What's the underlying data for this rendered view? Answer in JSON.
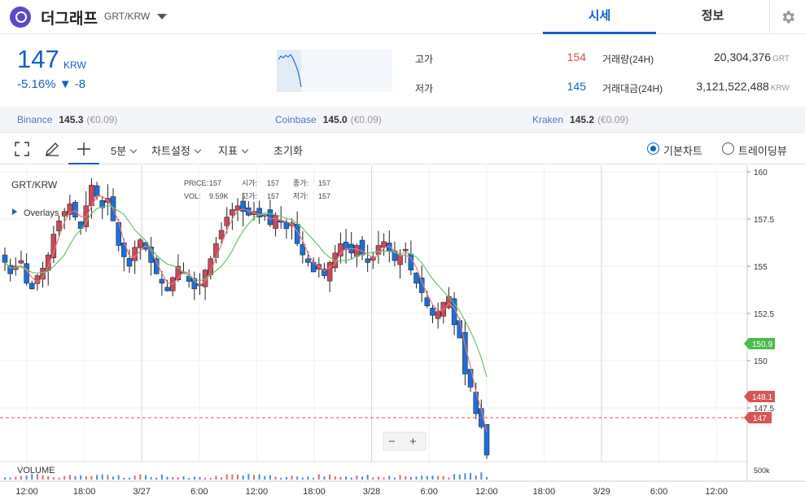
{
  "coin": {
    "name": "더그래프",
    "pair": "GRT/KRW"
  },
  "tabs": {
    "market": "시세",
    "info": "정보"
  },
  "summary": {
    "price": "147",
    "unit": "KRW",
    "change": "-5.16% ▼ -8",
    "high_label": "고가",
    "high": "154",
    "low_label": "저가",
    "low": "145",
    "volume_label": "거래량(24H)",
    "volume": "20,304,376",
    "volume_unit": "GRT",
    "amount_label": "거래대금(24H)",
    "amount": "3,121,522,488",
    "amount_unit": "KRW"
  },
  "exchanges": [
    {
      "name": "Binance",
      "price": "145.3",
      "eur": "(€0.09)"
    },
    {
      "name": "Coinbase",
      "price": "145.0",
      "eur": "(€0.09)"
    },
    {
      "name": "Kraken",
      "price": "145.2",
      "eur": "(€0.09)"
    }
  ],
  "toolbar": {
    "interval": "5분",
    "settings": "차트설정",
    "indicators": "지표",
    "reset": "초기화",
    "basic_chart": "기본차트",
    "tradingview": "트레이딩뷰"
  },
  "chart": {
    "symbol": "GRT/KRW",
    "overlays": "Overlays",
    "price_label": "PRICE:",
    "price": "157",
    "open_label": "시가:",
    "open": "157",
    "close_label": "종가:",
    "close": "157",
    "vol_label": "VOL:",
    "vol": "9.59K",
    "high_label": "고가:",
    "high": "157",
    "low_label": "저가:",
    "low": "157",
    "volume_title": "VOLUME",
    "volume_tick": "500k",
    "zoom_minus": "−",
    "zoom_plus": "+",
    "y_ticks": [
      "160",
      "157.5",
      "155",
      "152.5",
      "150",
      "147.5"
    ],
    "x_ticks": [
      "12:00",
      "18:00",
      "3/27",
      "6:00",
      "12:00",
      "18:00",
      "3/28",
      "6:00",
      "12:00",
      "18:00",
      "3/29",
      "6:00",
      "12:00"
    ],
    "markers": {
      "ma_green": "150.9",
      "ma_red": "148.1",
      "last": "147"
    },
    "colors": {
      "up": "#c84a5a",
      "down": "#1d6fd6",
      "ma5": "#e57a86",
      "ma20": "#6cc46c",
      "accent": "#1261c4"
    }
  },
  "chart_data": {
    "type": "candlestick",
    "y_range": [
      146,
      160
    ],
    "x_tick_labels": [
      "12:00",
      "18:00",
      "3/27",
      "6:00",
      "12:00",
      "18:00",
      "3/28",
      "6:00",
      "12:00",
      "18:00",
      "3/29",
      "6:00",
      "12:00"
    ],
    "close_series": [
      155.2,
      154.6,
      155.0,
      155.3,
      154.1,
      153.8,
      154.5,
      154.9,
      155.6,
      156.7,
      157.4,
      157.9,
      158.3,
      157.6,
      157.0,
      158.2,
      159.3,
      158.7,
      158.1,
      158.6,
      157.4,
      156.1,
      155.5,
      155.0,
      156.0,
      156.4,
      155.9,
      155.2,
      154.6,
      154.1,
      153.7,
      154.4,
      155.0,
      154.7,
      154.2,
      153.8,
      154.0,
      154.8,
      155.4,
      156.2,
      156.9,
      157.6,
      158.0,
      158.2,
      157.9,
      157.7,
      157.9,
      157.6,
      157.7,
      157.2,
      157.7,
      157.4,
      157.0,
      157.3,
      156.2,
      155.6,
      155.2,
      154.7,
      155.1,
      154.5,
      155.2,
      155.7,
      156.2,
      155.9,
      155.7,
      156.1,
      155.6,
      155.2,
      155.5,
      156.1,
      156.3,
      155.8,
      155.3,
      155.6,
      155.9,
      154.8,
      154.1,
      153.6,
      152.9,
      152.4,
      152.6,
      153.1,
      153.4,
      151.9,
      151.2,
      149.3,
      148.6,
      147.2,
      146.5,
      145.0
    ]
  }
}
